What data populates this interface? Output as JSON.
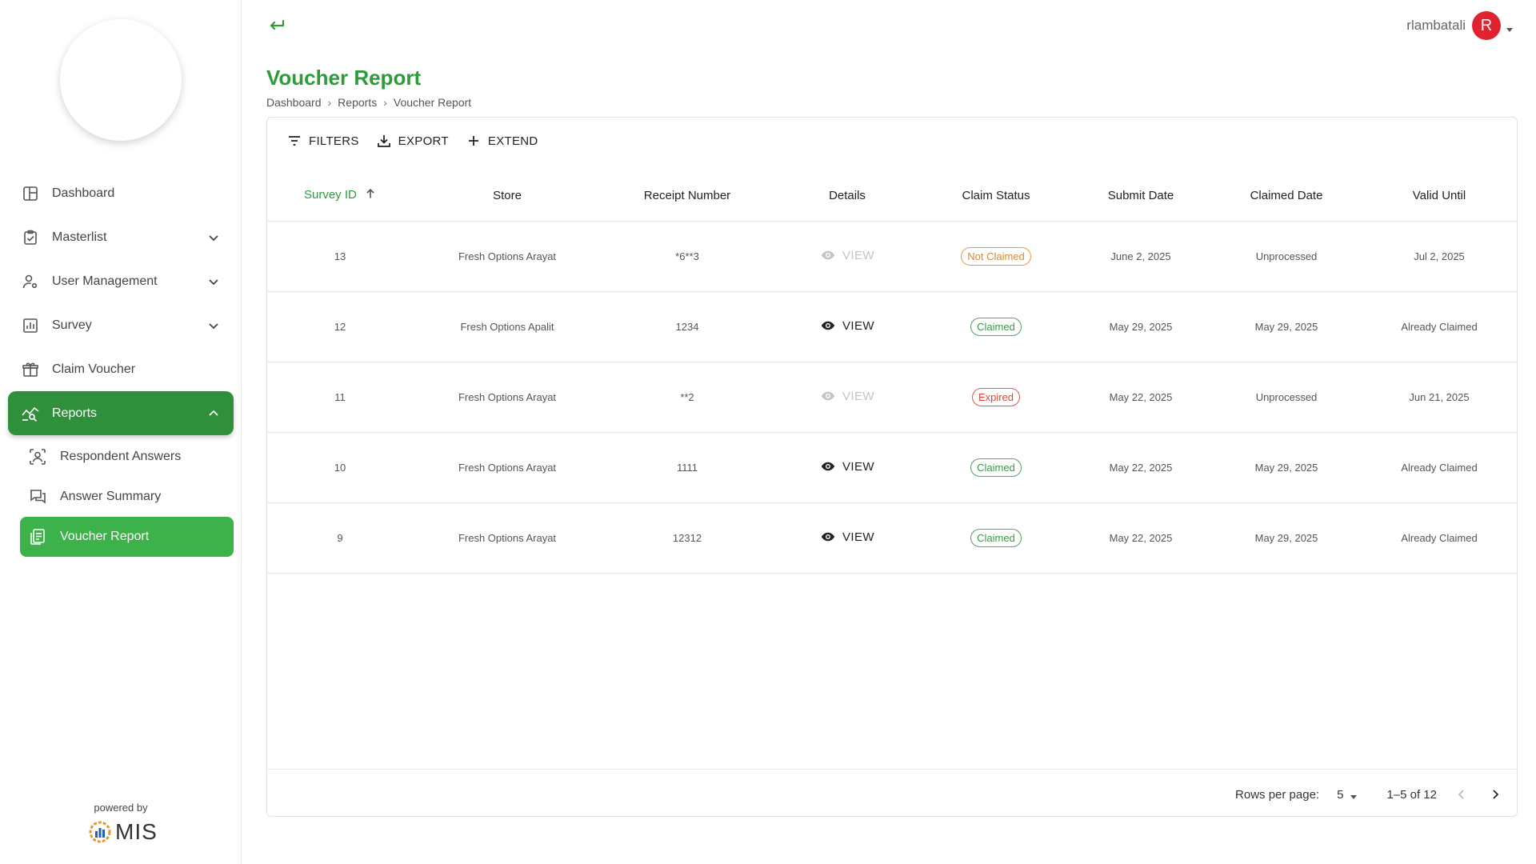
{
  "header": {
    "username": "rlambatali",
    "avatar_initial": "R"
  },
  "page": {
    "title": "Voucher Report",
    "breadcrumb": [
      "Dashboard",
      "Reports",
      "Voucher Report"
    ]
  },
  "sidebar": {
    "items": [
      {
        "label": "Dashboard",
        "icon": "dashboard-icon"
      },
      {
        "label": "Masterlist",
        "icon": "clipboard-check-icon",
        "expandable": true
      },
      {
        "label": "User Management",
        "icon": "user-gear-icon",
        "expandable": true
      },
      {
        "label": "Survey",
        "icon": "bar-chart-icon",
        "expandable": true
      },
      {
        "label": "Claim Voucher",
        "icon": "gift-icon"
      },
      {
        "label": "Reports",
        "icon": "analytics-icon",
        "expandable": true,
        "active": true
      }
    ],
    "sub_items": [
      {
        "label": "Respondent Answers",
        "icon": "person-scan-icon"
      },
      {
        "label": "Answer Summary",
        "icon": "chat-bubbles-icon"
      },
      {
        "label": "Voucher Report",
        "icon": "report-document-icon",
        "active": true
      }
    ],
    "powered_by": "powered by",
    "brand": "MIS"
  },
  "toolbar": {
    "filters": "FILTERS",
    "export": "EXPORT",
    "extend": "EXTEND"
  },
  "table": {
    "columns": [
      "Survey ID",
      "Store",
      "Receipt Number",
      "Details",
      "Claim Status",
      "Submit Date",
      "Claimed Date",
      "Valid Until"
    ],
    "view_label": "VIEW",
    "rows": [
      {
        "id": "13",
        "store": "Fresh Options Arayat",
        "receipt": "*6**3",
        "view_enabled": false,
        "status": "Not Claimed",
        "status_type": "not-claimed",
        "submit": "June 2, 2025",
        "claimed": "Unprocessed",
        "valid": "Jul 2, 2025"
      },
      {
        "id": "12",
        "store": "Fresh Options Apalit",
        "receipt": "1234",
        "view_enabled": true,
        "status": "Claimed",
        "status_type": "claimed",
        "submit": "May 29, 2025",
        "claimed": "May 29, 2025",
        "valid": "Already Claimed"
      },
      {
        "id": "11",
        "store": "Fresh Options Arayat",
        "receipt": "**2",
        "view_enabled": false,
        "status": "Expired",
        "status_type": "expired",
        "submit": "May 22, 2025",
        "claimed": "Unprocessed",
        "valid": "Jun 21, 2025"
      },
      {
        "id": "10",
        "store": "Fresh Options Arayat",
        "receipt": "1111",
        "view_enabled": true,
        "status": "Claimed",
        "status_type": "claimed",
        "submit": "May 22, 2025",
        "claimed": "May 29, 2025",
        "valid": "Already Claimed"
      },
      {
        "id": "9",
        "store": "Fresh Options Arayat",
        "receipt": "12312",
        "view_enabled": true,
        "status": "Claimed",
        "status_type": "claimed",
        "submit": "May 22, 2025",
        "claimed": "May 29, 2025",
        "valid": "Already Claimed"
      }
    ]
  },
  "pagination": {
    "rows_per_page_label": "Rows per page:",
    "rows_per_page": "5",
    "range": "1–5 of 12"
  },
  "colors": {
    "brand_green": "#2e9b3b",
    "active_nav": "#2f8f3a",
    "active_sub": "#3db24a",
    "avatar": "#e0242f"
  }
}
